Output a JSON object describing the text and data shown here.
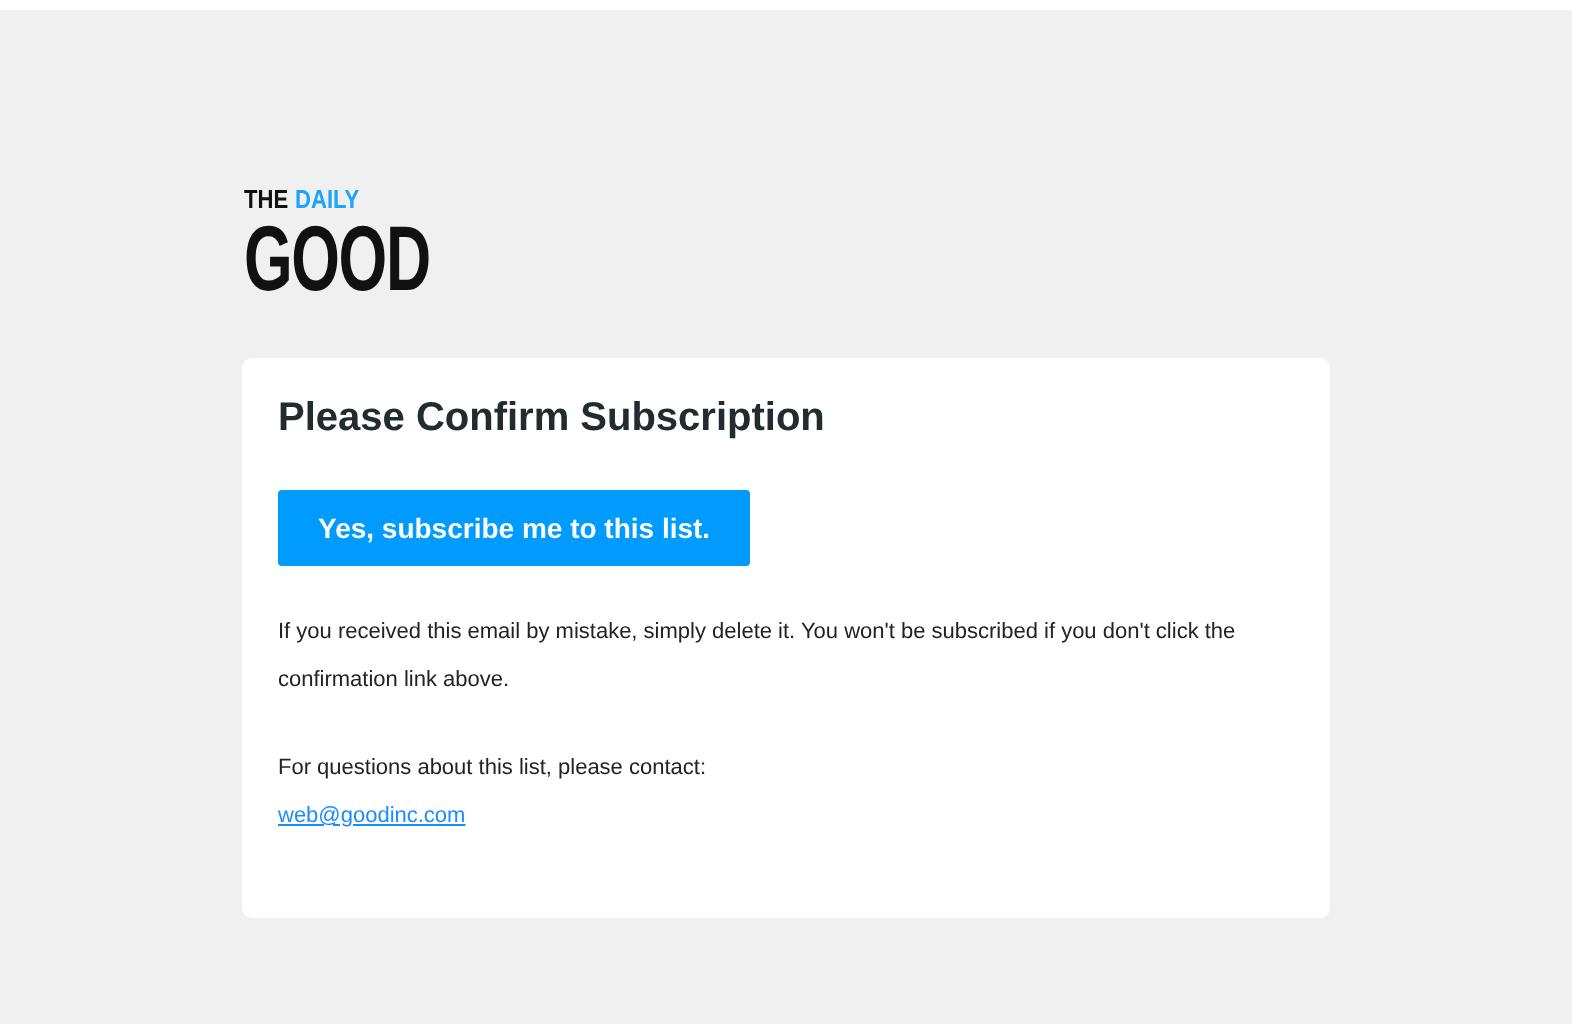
{
  "logo": {
    "prefix": "THE",
    "highlight": "DAILY",
    "name": "GOOD"
  },
  "card": {
    "title": "Please Confirm Subscription",
    "button": "Yes, subscribe me to this list.",
    "notice": "If you received this email by mistake, simply delete it. You won't be subscribed if you don't click the confirmation link above.",
    "contact_text": "For questions about this list, please contact:",
    "contact_email": "web@goodinc.com"
  }
}
